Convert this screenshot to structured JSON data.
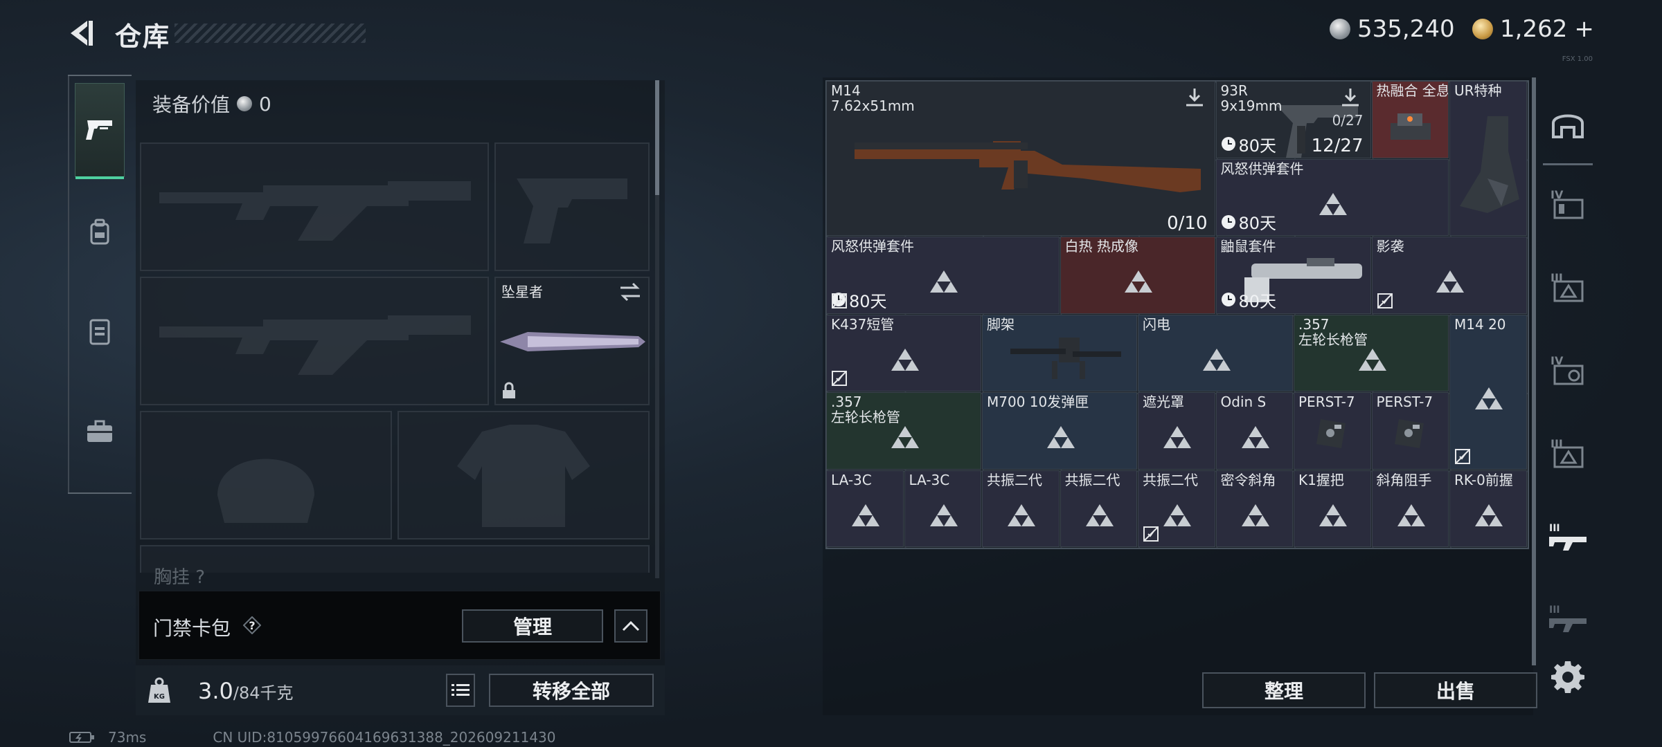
{
  "header": {
    "title": "仓库",
    "currency_silver": "535,240",
    "currency_gold": "1,262",
    "gold_plus": "+",
    "tiny_code": "FSX 1.00"
  },
  "left_tabs": [
    {
      "name": "weapons",
      "icon": "pistol-icon",
      "active": true
    },
    {
      "name": "backpack",
      "icon": "backpack-icon",
      "active": false
    },
    {
      "name": "vest",
      "icon": "vest-icon",
      "active": false
    },
    {
      "name": "case",
      "icon": "briefcase-icon",
      "active": false
    }
  ],
  "equipment": {
    "value_label": "装备价值",
    "value": "0",
    "melee_name": "坠星者",
    "chest_label": "胸挂",
    "chest_help": "?"
  },
  "keycard": {
    "label": "门禁卡包",
    "help": "?",
    "manage_label": "管理"
  },
  "weight": {
    "current": "3.0",
    "max": "/84千克",
    "transfer_all_label": "转移全部"
  },
  "status": {
    "ping": "73ms",
    "uid": "CN UID:8105997660416963138​8_202609211430"
  },
  "stash_items": [
    {
      "id": "m14",
      "name": "M14\n7.62x51mm",
      "count": "0/10"
    },
    {
      "id": "93r",
      "name": "93R\n9x19mm",
      "small_count": "0/27",
      "timer": "80天",
      "count": "12/27"
    },
    {
      "id": "thermal-fusion",
      "name": "热融合 全息"
    },
    {
      "id": "ur-stock",
      "name": "UR特种"
    },
    {
      "id": "fury-kit-1",
      "name": "风怒供弹套件",
      "timer": "80天"
    },
    {
      "id": "fury-kit-2",
      "name": "风怒供弹套件",
      "timer": "80天"
    },
    {
      "id": "white-hot",
      "name": "白热 热成像"
    },
    {
      "id": "mole-kit",
      "name": "鼬鼠套件",
      "timer": "80天"
    },
    {
      "id": "shadow",
      "name": "影袭"
    },
    {
      "id": "k437",
      "name": "K437短管"
    },
    {
      "id": "bipod",
      "name": "脚架"
    },
    {
      "id": "flash",
      "name": "闪电"
    },
    {
      "id": "357-barrel-1",
      "name": ".357\n左轮长枪管"
    },
    {
      "id": "m14-20",
      "name": "M14 20"
    },
    {
      "id": "357-barrel-2",
      "name": ".357\n左轮长枪管"
    },
    {
      "id": "m700-mag",
      "name": "M700 10发弹匣"
    },
    {
      "id": "shade",
      "name": "遮光罩"
    },
    {
      "id": "odin",
      "name": "Odin S"
    },
    {
      "id": "perst-1",
      "name": "PERST-7"
    },
    {
      "id": "perst-2",
      "name": "PERST-7"
    },
    {
      "id": "la3c-1",
      "name": "LA-3C"
    },
    {
      "id": "la3c-2",
      "name": "LA-3C"
    },
    {
      "id": "resonance-1",
      "name": "共振二代"
    },
    {
      "id": "resonance-2",
      "name": "共振二代"
    },
    {
      "id": "resonance-3",
      "name": "共振二代"
    },
    {
      "id": "secret-angle",
      "name": "密令斜角"
    },
    {
      "id": "k1-grip",
      "name": "K1握把"
    },
    {
      "id": "angle-stop",
      "name": "斜角阻手"
    },
    {
      "id": "rk0-grip",
      "name": "RK-0前握"
    }
  ],
  "actions": {
    "sort_label": "整理",
    "sell_label": "出售"
  },
  "colors": {
    "accent": "#4fd0a0",
    "rarity_red": "#5a2b2e",
    "rarity_purple": "#2a2c3d",
    "rarity_blue": "#273445",
    "rarity_green": "#23352f"
  }
}
